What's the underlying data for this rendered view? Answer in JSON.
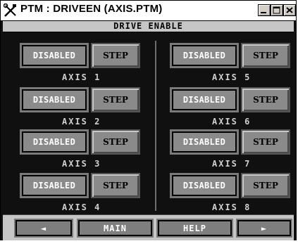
{
  "window": {
    "title": "PTM : DRIVEEN (AXIS.PTM)",
    "icon": "tools-icon",
    "controls": [
      "minimize-icon",
      "maximize-icon",
      "close-icon"
    ]
  },
  "section": {
    "title": "DRIVE ENABLE"
  },
  "axes": [
    {
      "status_label": "DISABLED",
      "step_label": "STEP",
      "axis_label": "AXIS 1"
    },
    {
      "status_label": "DISABLED",
      "step_label": "STEP",
      "axis_label": "AXIS 2"
    },
    {
      "status_label": "DISABLED",
      "step_label": "STEP",
      "axis_label": "AXIS 3"
    },
    {
      "status_label": "DISABLED",
      "step_label": "STEP",
      "axis_label": "AXIS 4"
    },
    {
      "status_label": "DISABLED",
      "step_label": "STEP",
      "axis_label": "AXIS 5"
    },
    {
      "status_label": "DISABLED",
      "step_label": "STEP",
      "axis_label": "AXIS 6"
    },
    {
      "status_label": "DISABLED",
      "step_label": "STEP",
      "axis_label": "AXIS 7"
    },
    {
      "status_label": "DISABLED",
      "step_label": "STEP",
      "axis_label": "AXIS 8"
    }
  ],
  "nav": {
    "prev_icon": "◄",
    "main_label": "MAIN",
    "help_label": "HELP",
    "next_icon": "►"
  },
  "colors": {
    "background": "#101010",
    "button_face": "#8a8a8a",
    "header_bar": "#c6c6c6"
  }
}
